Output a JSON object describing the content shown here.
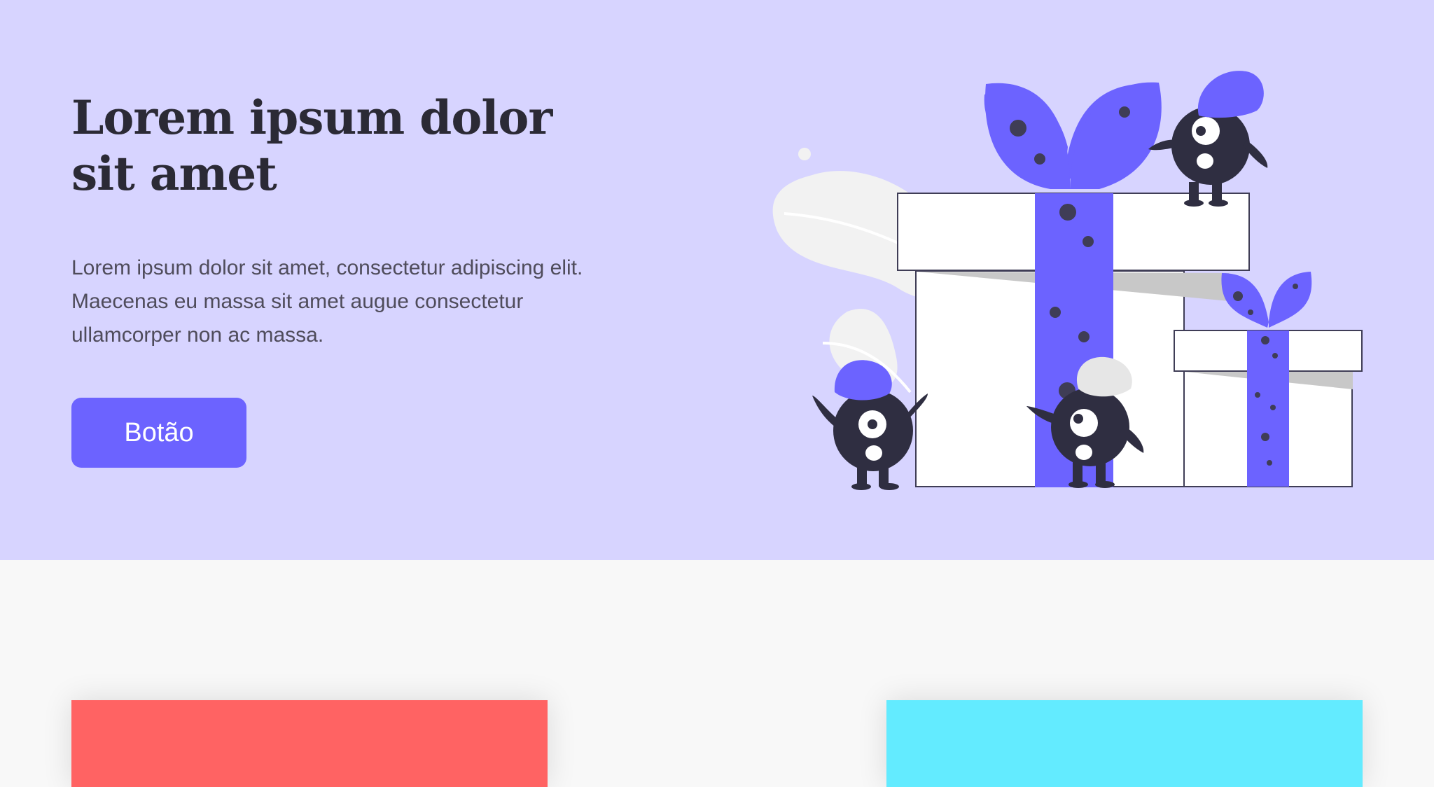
{
  "hero": {
    "title": "Lorem ipsum dolor sit amet",
    "body": "Lorem ipsum dolor sit amet, consectetur adipiscing elit. Maecenas eu massa sit amet augue consectetur ullamcorper non ac massa.",
    "button_label": "Botão"
  },
  "illustration": {
    "icon": "gift-boxes-with-monsters-illustration"
  },
  "cards": [
    {
      "color": "#ff6363"
    },
    {
      "color": "#63ebff"
    }
  ],
  "colors": {
    "hero_bg": "#d7d4ff",
    "accent": "#6c63ff",
    "page_bg": "#f8f8f8",
    "heading": "#2b2a35",
    "text": "#4f4c5b"
  }
}
